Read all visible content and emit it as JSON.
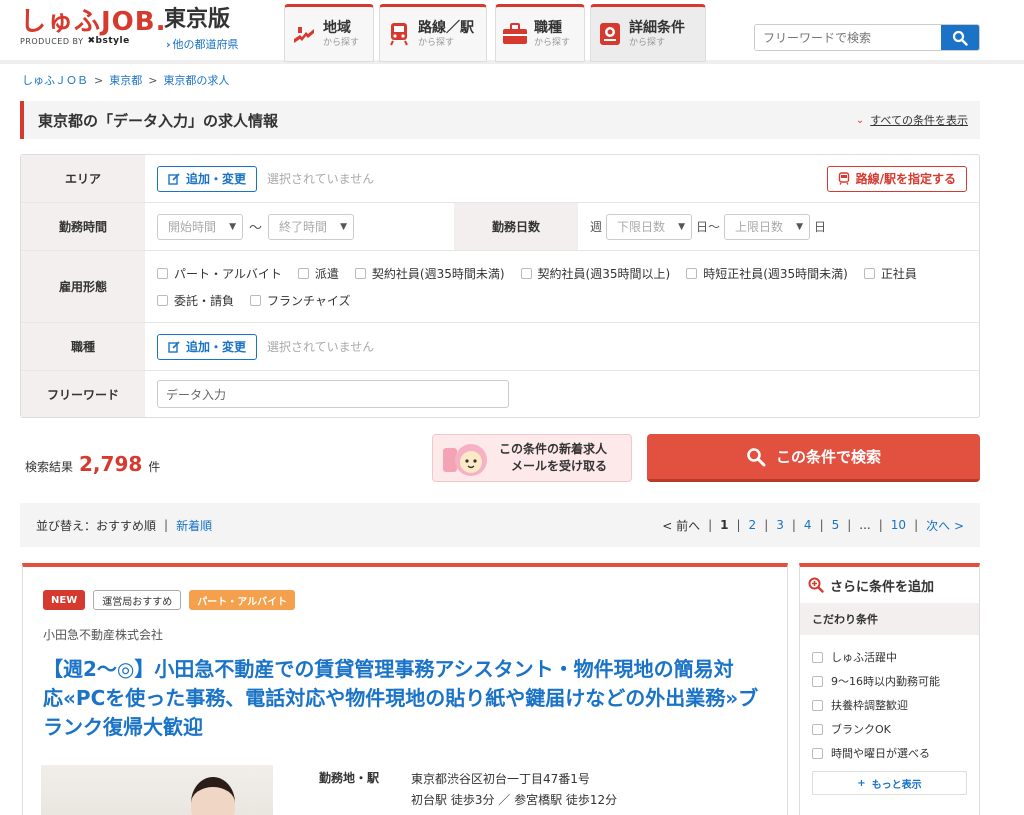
{
  "header": {
    "logo": "しゅふJOB.",
    "logo_sub_produced": "PRODUCED BY",
    "logo_sub_brand": "bstyle",
    "region": "東京版",
    "region_link": "他の都道府県",
    "nav": [
      {
        "title": "地域",
        "sub": "から探す",
        "icon": "map-icon"
      },
      {
        "title": "路線／駅",
        "sub": "から探す",
        "icon": "train-icon"
      },
      {
        "title": "職種",
        "sub": "から探す",
        "icon": "briefcase-icon"
      },
      {
        "title": "詳細条件",
        "sub": "から探す",
        "icon": "checklist-icon"
      }
    ],
    "search_placeholder": "フリーワードで検索"
  },
  "breadcrumb": [
    "しゅふＪＯＢ",
    "東京都",
    "東京都の求人"
  ],
  "title_bar": {
    "title": "東京都の「データ入力」の求人情報",
    "show_all": "すべての条件を表示"
  },
  "filter": {
    "area_label": "エリア",
    "edit_button": "追加・変更",
    "not_selected": "選択されていません",
    "rail_button": "路線/駅を指定する",
    "hours_label": "勤務時間",
    "start_time": "開始時間",
    "time_sep": "〜",
    "end_time": "終了時間",
    "days_label": "勤務日数",
    "week": "週",
    "min_days": "下限日数",
    "day_sep": "日〜",
    "max_days": "上限日数",
    "day": "日",
    "employment_label": "雇用形態",
    "employment_options": [
      "パート・アルバイト",
      "派遣",
      "契約社員(週35時間未満)",
      "契約社員(週35時間以上)",
      "時短正社員(週35時間未満)",
      "正社員",
      "委託・請負",
      "フランチャイズ"
    ],
    "job_label": "職種",
    "job_edit_button": "追加・変更",
    "job_not_selected": "選択されていません",
    "freeword_label": "フリーワード",
    "freeword_value": "データ入力"
  },
  "results": {
    "label": "検索結果",
    "count": "2,798",
    "unit": "件",
    "mail_line1": "この条件の新着求人",
    "mail_line2": "メールを受け取る",
    "search_button": "この条件で検索"
  },
  "sort": {
    "label": "並び替え：おすすめ順",
    "sep": "|",
    "newest": "新着順",
    "prev": "< 前へ",
    "pages": [
      "1",
      "2",
      "3",
      "4",
      "5",
      "...",
      "10"
    ],
    "next": "次へ >"
  },
  "job": {
    "tag_new": "NEW",
    "tag_recommend": "運営局おすすめ",
    "tag_type": "パート・アルバイト",
    "company": "小田急不動産株式会社",
    "title": "【週2〜◎】小田急不動産での賃貸管理事務アシスタント・物件現地の簡易対応«PCを使った事務、電話対応や物件現地の貼り紙や鍵届けなどの外出業務»ブランク復帰大歓迎",
    "location_label": "勤務地・駅",
    "address": "東京都渋谷区初台一丁目47番1号",
    "station": "初台駅 徒歩3分 ／ 参宮橋駅 徒歩12分"
  },
  "side": {
    "head": "さらに条件を追加",
    "sub": "こだわり条件",
    "items": [
      "しゅふ活躍中",
      "9〜16時以内勤務可能",
      "扶養枠調整歓迎",
      "ブランクOK",
      "時間や曜日が選べる"
    ],
    "more": "もっと表示"
  }
}
